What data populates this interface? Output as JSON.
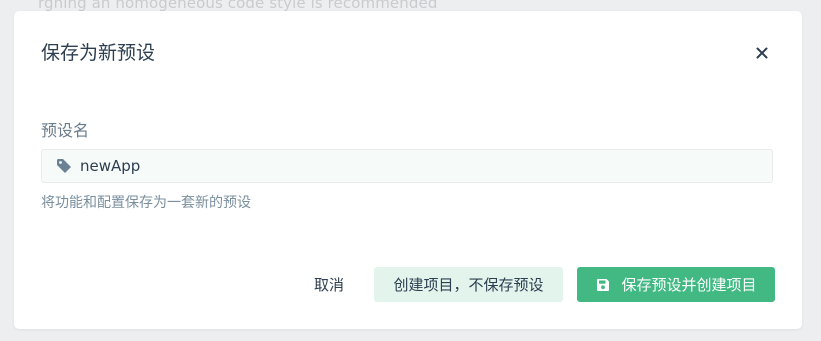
{
  "background": {
    "partial_text": "rgning an homogeneous code style is recommended"
  },
  "dialog": {
    "title": "保存为新预设",
    "close_icon": "close-icon",
    "field": {
      "label": "预设名",
      "value": "newApp",
      "icon": "tag-icon",
      "description": "将功能和配置保存为一套新的预设"
    },
    "buttons": {
      "cancel": "取消",
      "create_without_saving": "创建项目，不保存预设",
      "save_and_create": "保存预设并创建项目",
      "save_icon": "save-icon"
    }
  },
  "colors": {
    "accent": "#42b983",
    "accent_light": "#e3f4ec",
    "text_dark": "#2c3e50",
    "text_muted": "#6a7b8a"
  }
}
